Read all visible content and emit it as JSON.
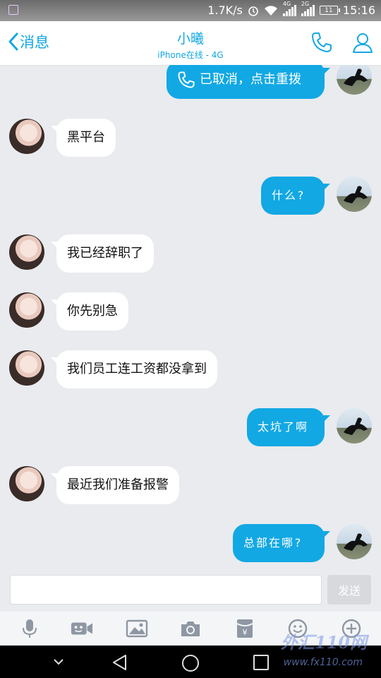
{
  "status_bar": {
    "network_speed": "1.7K/s",
    "time": "15:16",
    "battery": "11",
    "sig1_label": "4G",
    "sig2_label": "2G"
  },
  "header": {
    "back_label": "消息",
    "contact_name": "小曦",
    "status": "iPhone在线 - 4G"
  },
  "messages": [
    {
      "side": "out",
      "text": "已取消，点击重拨",
      "icon": "phone-icon"
    },
    {
      "side": "in",
      "text": "黑平台"
    },
    {
      "side": "out",
      "text": "什么?"
    },
    {
      "side": "in",
      "text": "我已经辞职了"
    },
    {
      "side": "in",
      "text": "你先别急"
    },
    {
      "side": "in",
      "text": "我们员工连工资都没拿到"
    },
    {
      "side": "out",
      "text": "太坑了啊"
    },
    {
      "side": "in",
      "text": "最近我们准备报警"
    },
    {
      "side": "out",
      "text": "总部在哪?"
    }
  ],
  "input": {
    "value": "",
    "placeholder": "",
    "send_label": "发送"
  },
  "toolbar": [
    "microphone-icon",
    "video-icon",
    "image-icon",
    "camera-icon",
    "red-packet-icon",
    "emoji-icon",
    "plus-icon"
  ],
  "watermark": {
    "main": "外汇110网",
    "url": "www.fx110.com"
  },
  "colors": {
    "accent": "#12a8e4",
    "background": "#e9ebef"
  }
}
